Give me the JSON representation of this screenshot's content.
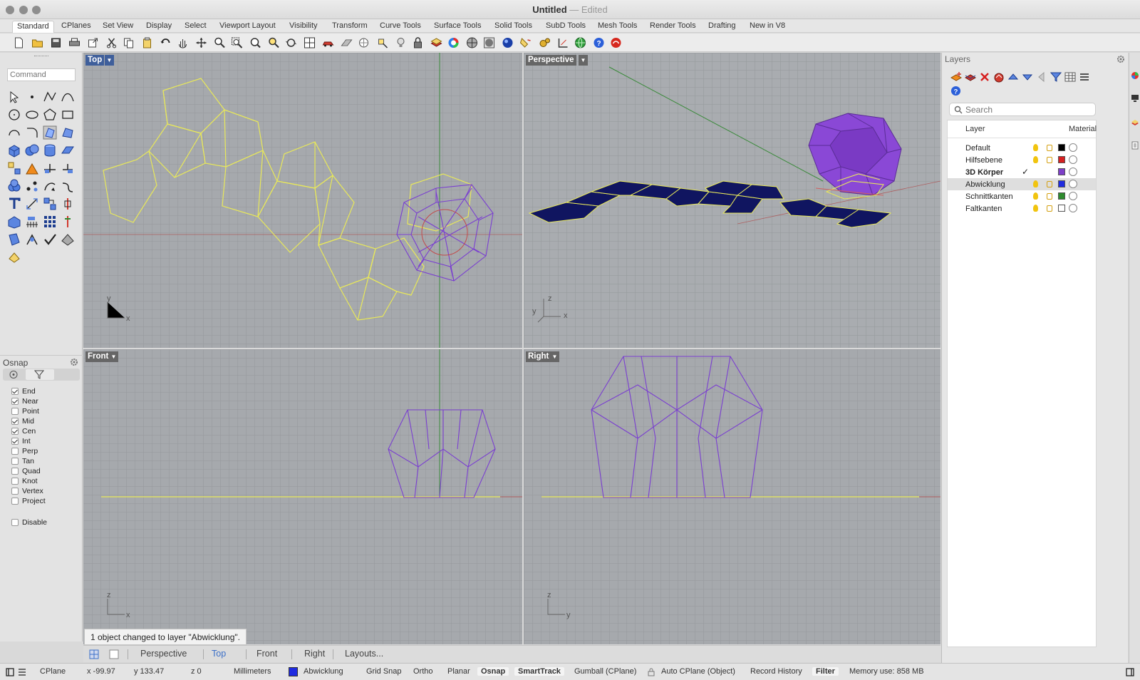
{
  "window": {
    "title": "Untitled",
    "subtitle": "— Edited"
  },
  "tabs": [
    "Standard",
    "CPlanes",
    "Set View",
    "Display",
    "Select",
    "Viewport Layout",
    "Visibility",
    "Transform",
    "Curve Tools",
    "Surface Tools",
    "Solid Tools",
    "SubD Tools",
    "Mesh Tools",
    "Render Tools",
    "Drafting",
    "New in V8"
  ],
  "command": {
    "placeholder": "Command"
  },
  "osnap": {
    "title": "Osnap",
    "items": [
      {
        "label": "End",
        "checked": true
      },
      {
        "label": "Near",
        "checked": true
      },
      {
        "label": "Point",
        "checked": false
      },
      {
        "label": "Mid",
        "checked": true
      },
      {
        "label": "Cen",
        "checked": true
      },
      {
        "label": "Int",
        "checked": true
      },
      {
        "label": "Perp",
        "checked": false
      },
      {
        "label": "Tan",
        "checked": false
      },
      {
        "label": "Quad",
        "checked": false
      },
      {
        "label": "Knot",
        "checked": false
      },
      {
        "label": "Vertex",
        "checked": false
      },
      {
        "label": "Project",
        "checked": false
      }
    ],
    "disable": "Disable"
  },
  "viewports": {
    "top": {
      "label": "Top",
      "axis_a": "y",
      "axis_b": "x"
    },
    "perspective": {
      "label": "Perspective",
      "axis_a": "z",
      "axis_b": "y",
      "axis_c": "x"
    },
    "front": {
      "label": "Front",
      "axis_a": "z",
      "axis_b": "x"
    },
    "right": {
      "label": "Right",
      "axis_a": "z",
      "axis_b": "y"
    }
  },
  "view_tabs": [
    "Perspective",
    "Top",
    "Front",
    "Right",
    "Layouts..."
  ],
  "toast": "1 object changed to layer \"Abwicklung\".",
  "layers": {
    "title": "Layers",
    "search_placeholder": "Search",
    "col_layer": "Layer",
    "col_material": "Material",
    "rows": [
      {
        "name": "Default",
        "color": "#000000",
        "current": false,
        "selected": false
      },
      {
        "name": "Hilfsebene",
        "color": "#d62020",
        "current": false,
        "selected": false
      },
      {
        "name": "3D Körper",
        "color": "#7d3fc8",
        "current": true,
        "selected": false
      },
      {
        "name": "Abwicklung",
        "color": "#1f2be0",
        "current": false,
        "selected": true
      },
      {
        "name": "Schnittkanten",
        "color": "#2e8b2e",
        "current": false,
        "selected": false
      },
      {
        "name": "Faltkanten",
        "color": "#ffffff",
        "current": false,
        "selected": false
      }
    ]
  },
  "status": {
    "cplane": "CPlane",
    "x": "x -99.97",
    "y": "y 133.47",
    "z": "z 0",
    "units": "Millimeters",
    "layer": "Abwicklung",
    "layer_color": "#1f2be0",
    "grid_snap": "Grid Snap",
    "ortho": "Ortho",
    "planar": "Planar",
    "osnap": "Osnap",
    "smarttrack": "SmartTrack",
    "gumball": "Gumball (CPlane)",
    "auto_cplane": "Auto CPlane (Object)",
    "record_history": "Record History",
    "filter": "Filter",
    "memory": "Memory use: 858 MB"
  }
}
